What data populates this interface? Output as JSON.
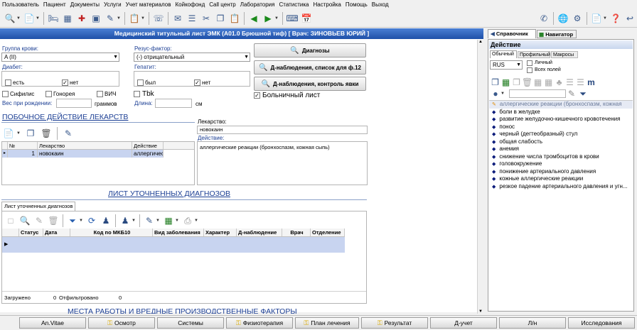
{
  "menu": [
    "Пользователь",
    "Пациент",
    "Документы",
    "Услуги",
    "Учет материалов",
    "Койкофонд",
    "Call центр",
    "Лаборатория",
    "Статистика",
    "Настройка",
    "Помощь",
    "Выход"
  ],
  "toolbar_icons": [
    "patient-search-icon",
    "card-icon",
    "bed-icon",
    "bed-icon",
    "doctor-icon",
    "id-card-icon",
    "phone-icon",
    "list-icon",
    "mail-icon",
    "report-icon",
    "scissors-icon",
    "copy-icon",
    "print-icon",
    "print-icon",
    "back-icon",
    "forward-icon",
    "keyboard-icon",
    "calendar-icon",
    "document-icon",
    "refresh-icon",
    "clock-icon",
    "settings-icon",
    "help-icon",
    "exit-icon"
  ],
  "title": "Медицинский титульный лист ЭМК (А01.0 Брюшной тиф)  [ Врач: ЗИНОВЬЕВ ЮРИЙ ]",
  "form": {
    "blood_group_label": "Группа крови:",
    "blood_group_value": "A (II)",
    "rh_label": "Резус-фактор:",
    "rh_value": "(-) отрицательный",
    "diabetes_label": "Диабет:",
    "diabetes_yes": "есть",
    "diabetes_no": "нет",
    "hepatitis_label": "Гепатит:",
    "hepatitis_yes": "был",
    "hepatitis_no": "нет",
    "syphilis": "Сифилис",
    "gonorrhea": "Гонорея",
    "hiv": "ВИЧ",
    "tbk": "Tbk",
    "birth_weight_label": "Вес при рождении:",
    "birth_weight_unit": "граммов",
    "height_label": "Длина:",
    "height_unit": "см",
    "hospital_sheet": "Больничный лист"
  },
  "buttons": {
    "diagnoses": "Диагнозы",
    "d_observation": "Д-наблюдения, список для ф.12",
    "d_control": "Д-наблюдения, контроль явки"
  },
  "side_effects": {
    "title": "ПОБОЧНОЕ ДЕЙСТВИЕ ЛЕКАРСТВ",
    "columns": [
      "№",
      "Лекарство",
      "Действие"
    ],
    "rows": [
      {
        "num": "1",
        "drug": "новокаин",
        "action": "аллергическ"
      }
    ],
    "drug_label": "Лекарство:",
    "drug_value": "новокаин",
    "action_label": "Действие:",
    "action_value": "аллергические реакции (бронхоспазм, кожная сыпь)"
  },
  "diagnoses": {
    "title": "ЛИСТ УТОЧНЕННЫХ ДИАГНОЗОВ",
    "tab": "Лист уточненных диагнозов",
    "columns": [
      "Статус",
      "Дата",
      "Код по МКБ10",
      "Вид заболевания",
      "Характер",
      "Д-наблюдение",
      "Врач",
      "Отделение"
    ],
    "loaded_label": "Загружено",
    "loaded_value": "0",
    "filtered_label": "Отфильтровано",
    "filtered_value": "0"
  },
  "next_section": "МЕСТА РАБОТЫ И ВРЕДНЫЕ ПРОИЗВОДСТВЕННЫЕ ФАКТОРЫ",
  "right": {
    "tab_reference": "Справочник",
    "tab_navigator": "Навигатор",
    "header": "Действие",
    "subtabs": [
      "Обычный",
      "Профильный",
      "Макросы"
    ],
    "lang": "RUS",
    "personal": "Личный",
    "all_fields": "Всех полей",
    "items": [
      "аллергические реакции (бронхоспазм, кожная",
      "боли в желудке",
      "развитие желудочно-кишечного кровотечения",
      "понос",
      "черный (дегтеобразный) стул",
      "общая слабость",
      "анемия",
      "снижение числа тромбоцитов в крови",
      "головокружение",
      "понижение артериального давления",
      "кожные аллергические реакции",
      "резкое падение артериального давления и угн..."
    ]
  },
  "bottom_buttons": [
    "An.Vitae",
    "Осмотр",
    "Системы",
    "Физиотерапия",
    "План лечения",
    "Результат",
    "Д-учет",
    "Л/н",
    "Исследования"
  ]
}
